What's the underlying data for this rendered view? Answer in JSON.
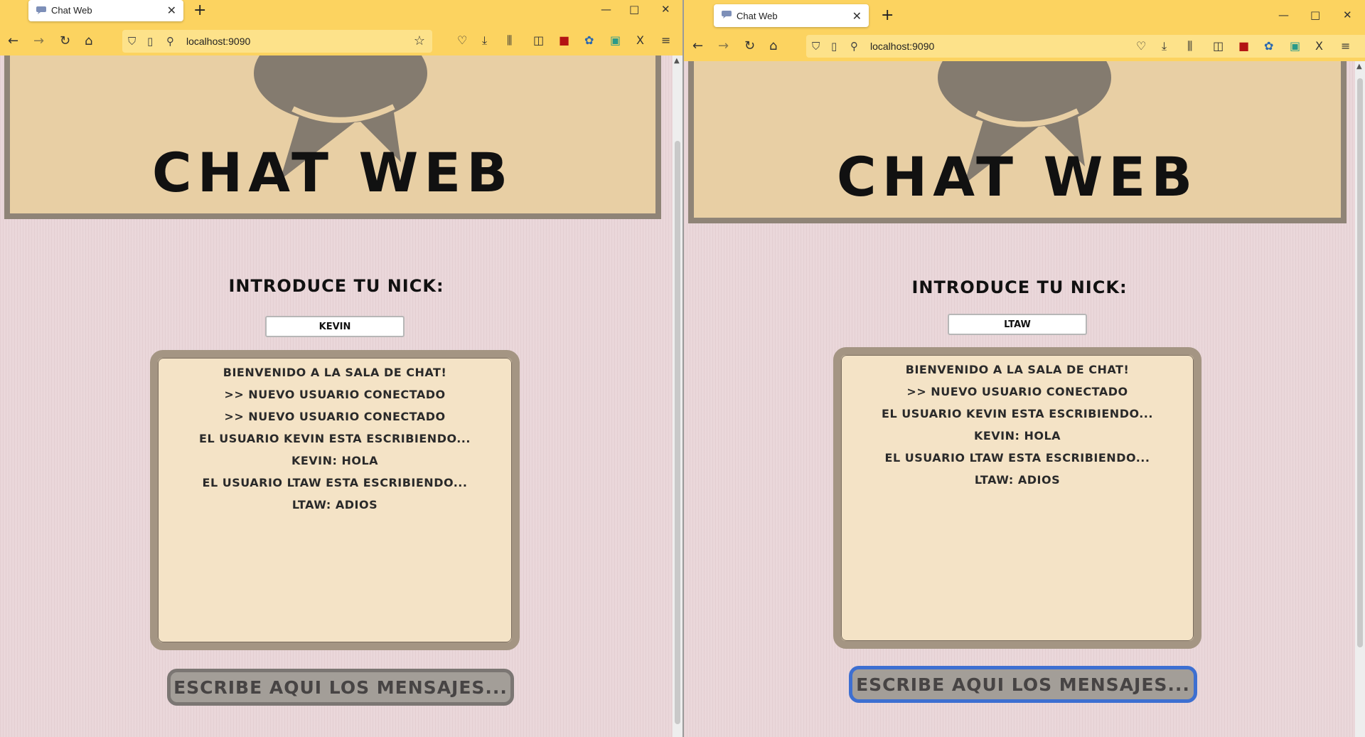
{
  "windows": [
    {
      "tab_title": "Chat Web",
      "url": "localhost:9090",
      "page": {
        "title": "CHAT WEB",
        "nick_label": "Introduce tu nick:",
        "nick_value": "KEVIN",
        "messages": [
          "Bienvenido a la sala de chat!",
          ">> Nuevo usuario conectado",
          ">> Nuevo usuario conectado",
          "El usuario KEVIN esta escribiendo...",
          "KEVIN: hola",
          "El usuario LTAW esta escribiendo...",
          "LTAW: adios"
        ],
        "message_placeholder": "Escribe aqui los mensajes..."
      }
    },
    {
      "tab_title": "Chat Web",
      "url": "localhost:9090",
      "page": {
        "title": "CHAT WEB",
        "nick_label": "Introduce tu nick:",
        "nick_value": "LTAW",
        "messages": [
          "Bienvenido a la sala de chat!",
          ">> Nuevo usuario conectado",
          "El usuario KEVIN esta escribiendo...",
          "KEVIN: hola",
          "El usuario LTAW esta escribiendo...",
          "LTAW: adios"
        ],
        "message_placeholder": "Escribe aqui los mensajes..."
      }
    }
  ],
  "icons": {
    "back": "←",
    "forward": "→",
    "reload": "↻",
    "home": "⌂",
    "shield": "⛉",
    "page": "▯",
    "permissions": "⚲",
    "bookmark_star": "☆",
    "pocket": "♡",
    "download": "⤓",
    "library": "⫼",
    "sidebar": "◫",
    "ublock": "■",
    "ext_blue": "✿",
    "ext_teal": "▣",
    "ext_x": "X",
    "menu": "≡",
    "minimize": "—",
    "maximize": "□",
    "close": "✕",
    "tab_close": "✕",
    "new_tab": "+"
  },
  "colors": {
    "toolbar": "#fcd360",
    "page_bg": "#ead7da",
    "header_bg": "#e8cfa4",
    "chat_bg": "#f4e3c6",
    "chat_border": "#a49583",
    "focus_border": "#3d6fd1"
  }
}
